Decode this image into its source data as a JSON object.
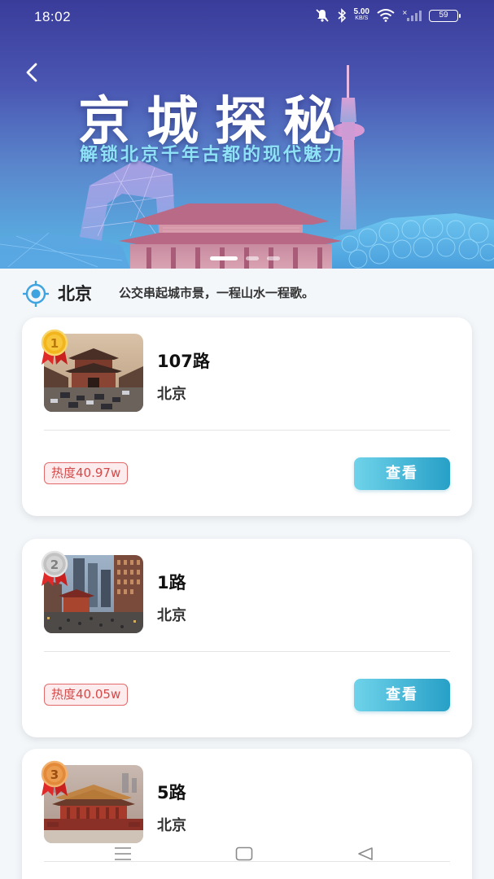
{
  "status_bar": {
    "time": "18:02",
    "net_speed_value": "5.00",
    "net_speed_unit": "KB/S",
    "battery": "59",
    "icons": [
      "mute-icon",
      "bluetooth-icon",
      "wifi-icon",
      "signal-off-icon"
    ]
  },
  "banner": {
    "title": "京城探秘",
    "subtitle": "解锁北京千年古都的现代魅力",
    "back_icon": "chevron-left-icon",
    "slide_count": 3,
    "active_slide": 0
  },
  "location": {
    "icon": "location-target-icon",
    "city": "北京",
    "slogan": "公交串起城市景，一程山水一程歌。"
  },
  "routes": [
    {
      "rank": "1",
      "name": "107路",
      "city": "北京",
      "heat": "热度40.97w",
      "button": "查看",
      "medal": "gold"
    },
    {
      "rank": "2",
      "name": "1路",
      "city": "北京",
      "heat": "热度40.05w",
      "button": "查看",
      "medal": "silver"
    },
    {
      "rank": "3",
      "name": "5路",
      "city": "北京",
      "heat": "",
      "button": "",
      "medal": "bronze"
    }
  ],
  "colors": {
    "gold": "#f2b51d",
    "silver": "#c2c2c2",
    "bronze": "#e38a3a",
    "ribbon": "#e02a2a",
    "button_start": "#6fd3ea",
    "button_end": "#27a0c7",
    "heat": "#d24a4a"
  },
  "nav_bar": {
    "icons": [
      "menu-icon",
      "home-square-icon",
      "back-triangle-icon"
    ]
  }
}
